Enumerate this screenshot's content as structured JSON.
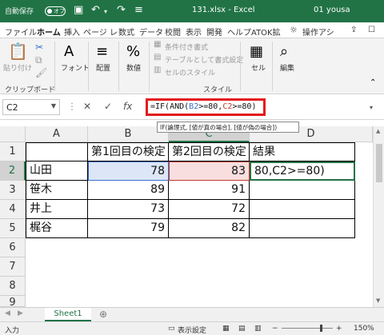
{
  "titlebar": {
    "autosave": "自動保存",
    "toggle": "オフ",
    "filename": "131.xlsx  -  Excel",
    "user": "01 yousa"
  },
  "tabs": [
    "ファイル",
    "ホーム",
    "挿入",
    "ページ レ",
    "数式",
    "データ",
    "校閲",
    "表示",
    "開発",
    "ヘルプ",
    "ATOK拡",
    "操作アシ"
  ],
  "ribbon": {
    "paste": "貼り付け",
    "clipboard": "クリップボード",
    "font": "フォント",
    "alignment": "配置",
    "number": "数値",
    "cond_format": "条件付き書式",
    "table_format": "テーブルとして書式設定",
    "cell_styles": "セルのスタイル",
    "styles": "スタイル",
    "cells": "セル",
    "editing": "編集"
  },
  "formula_bar": {
    "name_box": "C2",
    "cancel": "✕",
    "enter": "✓",
    "fx": "fx",
    "formula_prefix": "=IF(AND(",
    "ref_b2": "B2",
    "mid": ">=80,",
    "ref_c2": "C2",
    "suffix": ">=80)"
  },
  "tooltip": "IF(論理式, [値が真の場合], [値が偽の場合])",
  "grid": {
    "columns": [
      "A",
      "B",
      "C",
      "D"
    ],
    "rows": [
      "1",
      "2",
      "3",
      "4",
      "5",
      "6",
      "7",
      "8",
      "9"
    ],
    "header_row": [
      "",
      "第1回目の検定",
      "第2回目の検定",
      "結果"
    ],
    "data": [
      [
        "山田",
        "78",
        "83",
        "80,C2>=80)"
      ],
      [
        "笹木",
        "89",
        "91",
        ""
      ],
      [
        "井上",
        "73",
        "72",
        ""
      ],
      [
        "梶谷",
        "79",
        "82",
        ""
      ]
    ]
  },
  "sheet_tab": "Sheet1",
  "status": {
    "mode": "入力",
    "display_settings": "表示設定",
    "zoom": "150%"
  }
}
